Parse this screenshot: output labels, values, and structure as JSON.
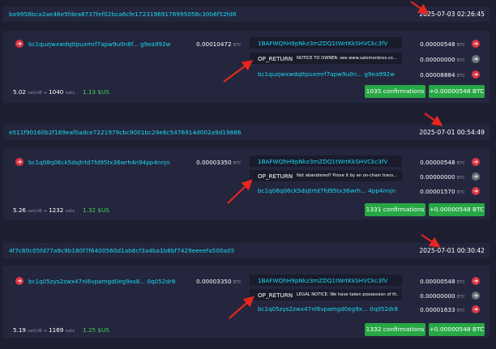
{
  "currency_unit": "BTC",
  "colors": {
    "background": "#1d1f31",
    "panel": "#24263d",
    "link": "#1bd8f4",
    "confirm": "#28a745",
    "arrow_red": "#dc3545",
    "arrow_grey": "#6c757d",
    "annotation": "#e8251e"
  },
  "icons": {
    "input_arrow": "arrow-right-circle-icon",
    "spent_output": "arrow-right-circle-icon",
    "unspendable_output": "arrow-right-circle-icon"
  },
  "transactions": [
    {
      "txid": "ba9958bca2ae46e5fdea8737fef02bca6cfe17231969176995058c30b6f52fd8",
      "timestamp": "2025-07-03 02:26:45",
      "input": {
        "address": "bc1quzjwxwdqttpuxmrf7apw9u0n8f... g9ea992w",
        "amount": "0.00010472"
      },
      "outputs": [
        {
          "address": "1BAFWQhH9pNkz3mZDQ1tWrtKkSHVCkc3fV",
          "amount": "0.00000548"
        },
        {
          "label": "OP_RETURN",
          "message": "NOTICE TO OWNER: see www.salomonbros.co...",
          "amount": "0.00000000"
        },
        {
          "address": "bc1quzjwxwdqttpuxmrf7apw9u0n... g9ea992w",
          "amount": "0.00008884"
        }
      ],
      "fee_rate": "5.02",
      "fee_rate_unit": "sat/vB",
      "fee": "1040",
      "fee_unit": "sats",
      "usd": "1.13 $US",
      "confirmations": "1035 confirmations",
      "total": "+0.00000548 BTC"
    },
    {
      "txid": "e511f90160b2f189eaf0adce7221979cbc9001bc29e6c5476914d002a9d19886",
      "timestamp": "2025-07-01 00:54:49",
      "input": {
        "address": "bc1q08q06ck5dsjtrtd7fd95tx36wrh4n94pp4nnjn",
        "amount": "0.00003350"
      },
      "outputs": [
        {
          "address": "1BAFWQhH9pNkz3mZDQ1tWrtKkSHVCkc3fV",
          "amount": "0.00000548"
        },
        {
          "label": "OP_RETURN",
          "message": "Not abandoned? Prove it by an on-chain trans...",
          "amount": "0.00000000"
        },
        {
          "address": "bc1q08q06ck5dsjtrtd7fd95tx36wrh... 4pp4nnjn",
          "amount": "0.00001570"
        }
      ],
      "fee_rate": "5.26",
      "fee_rate_unit": "sat/vB",
      "fee": "1232",
      "fee_unit": "sats",
      "usd": "1.32 $US",
      "confirmations": "1331 confirmations",
      "total": "+0.00000548 BTC"
    },
    {
      "txid": "4f7c80c05fd77a9c9b180f7f6400560d1ab6cf3a4ba1b6bf7429eeeefa500a05",
      "timestamp": "2025-07-01 00:30:42",
      "input": {
        "address": "bc1q05zys2zwx47nl6vpamgd0eg9xs8... 0q052dr8",
        "amount": "0.00003350"
      },
      "outputs": [
        {
          "address": "1BAFWQhH9pNkz3mZDQ1tWrtKkSHVCkc3fV",
          "amount": "0.00000548"
        },
        {
          "label": "OP_RETURN",
          "message": "LEGAL NOTICE: We have taken possession of th...",
          "amount": "0.00000000"
        },
        {
          "address": "bc1q05zys2zwx47nl6vpamgd0eg9x... 0q052dr8",
          "amount": "0.00001633"
        }
      ],
      "fee_rate": "5.19",
      "fee_rate_unit": "sat/vB",
      "fee": "1169",
      "fee_unit": "sats",
      "usd": "1.25 $US",
      "confirmations": "1332 confirmations",
      "total": "+0.00000548 BTC"
    }
  ]
}
